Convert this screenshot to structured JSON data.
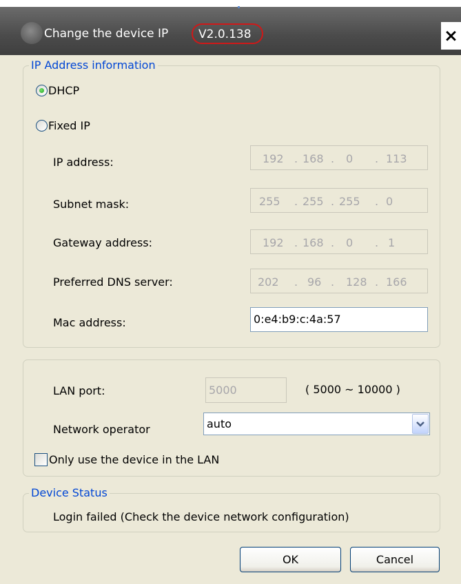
{
  "window": {
    "title": "Change the device IP",
    "version": "V2.0.138",
    "close_label": "×"
  },
  "ip_group": {
    "legend": "IP Address information",
    "dhcp_label": "DHCP",
    "fixed_label": "Fixed IP",
    "mode_selected": "DHCP",
    "ip_label": "IP address:",
    "ip_octets": [
      "192",
      "168",
      "0",
      "113"
    ],
    "subnet_label": "Subnet mask:",
    "subnet_octets": [
      "255",
      "255",
      "255",
      "0"
    ],
    "gateway_label": "Gateway address:",
    "gateway_octets": [
      "192",
      "168",
      "0",
      "1"
    ],
    "dns_label": "Preferred DNS server:",
    "dns_octets": [
      "202",
      "96",
      "128",
      "166"
    ],
    "mac_label": "Mac address:",
    "mac_value": "0:e4:b9:c:4a:57"
  },
  "lan_group": {
    "port_label": "LAN port:",
    "port_value": "5000",
    "port_range": "( 5000 ~ 10000 )",
    "operator_label": "Network operator",
    "operator_value": "auto",
    "lan_only_label": "Only use the device in the LAN",
    "lan_only_checked": false
  },
  "status_group": {
    "legend": "Device Status",
    "message": "Login failed (Check the device network configuration)"
  },
  "buttons": {
    "ok": "OK",
    "cancel": "Cancel"
  },
  "icons": {
    "app": "app-logo-icon",
    "close": "close-icon",
    "dropdown": "chevron-down-icon"
  }
}
